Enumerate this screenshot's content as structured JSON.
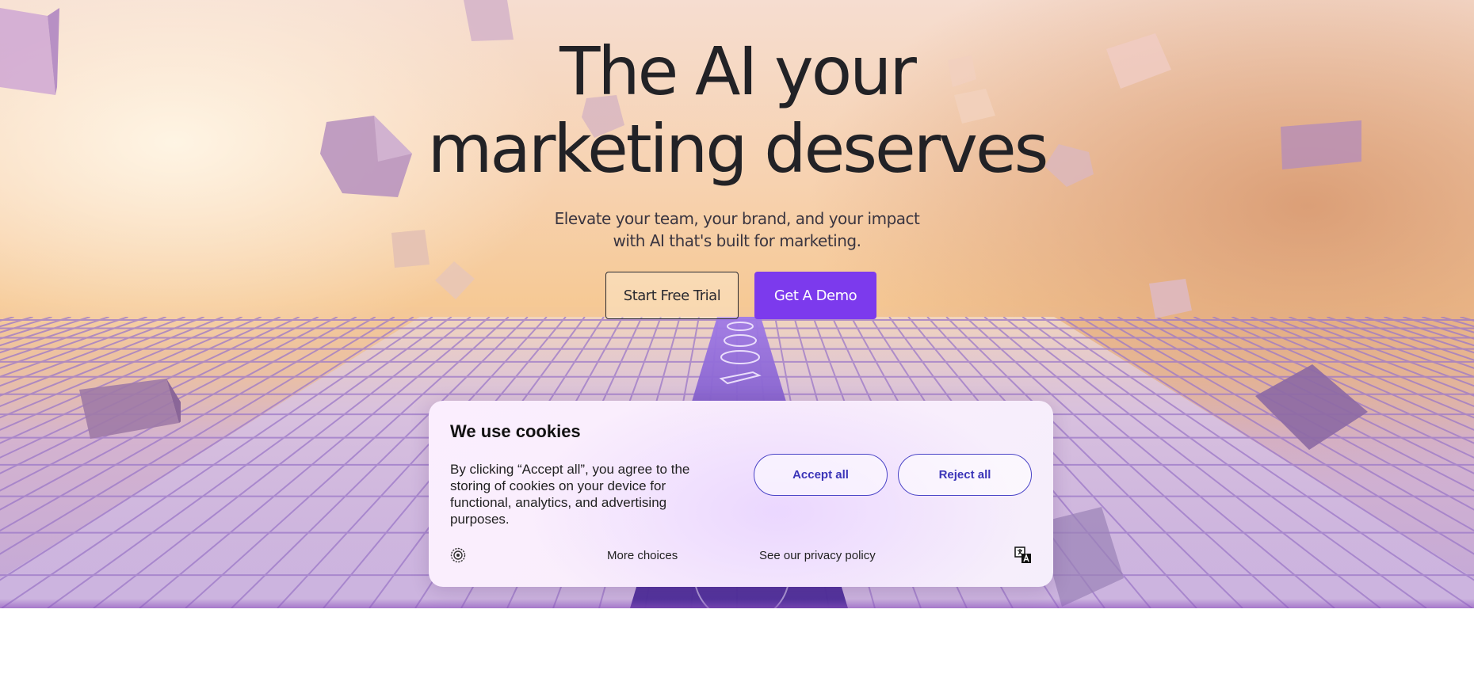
{
  "hero": {
    "headline_line1": "The AI your",
    "headline_line2": "marketing deserves",
    "subtitle_line1": "Elevate your team, your brand, and your impact",
    "subtitle_line2": "with AI that's built for marketing.",
    "cta_trial_label": "Start Free Trial",
    "cta_demo_label": "Get A Demo"
  },
  "cookie_banner": {
    "title": "We use cookies",
    "body": "By clicking “Accept all”, you agree to the storing of cookies on your device for functional, analytics, and advertising purposes.",
    "accept_label": "Accept all",
    "reject_label": "Reject all",
    "more_choices_label": "More choices",
    "privacy_label": "See our privacy policy",
    "settings_icon": "settings-icon",
    "language_icon": "translate-icon"
  },
  "colors": {
    "accent": "#7c3aed",
    "cookie_button": "#3b35b8",
    "headline": "#222226"
  }
}
